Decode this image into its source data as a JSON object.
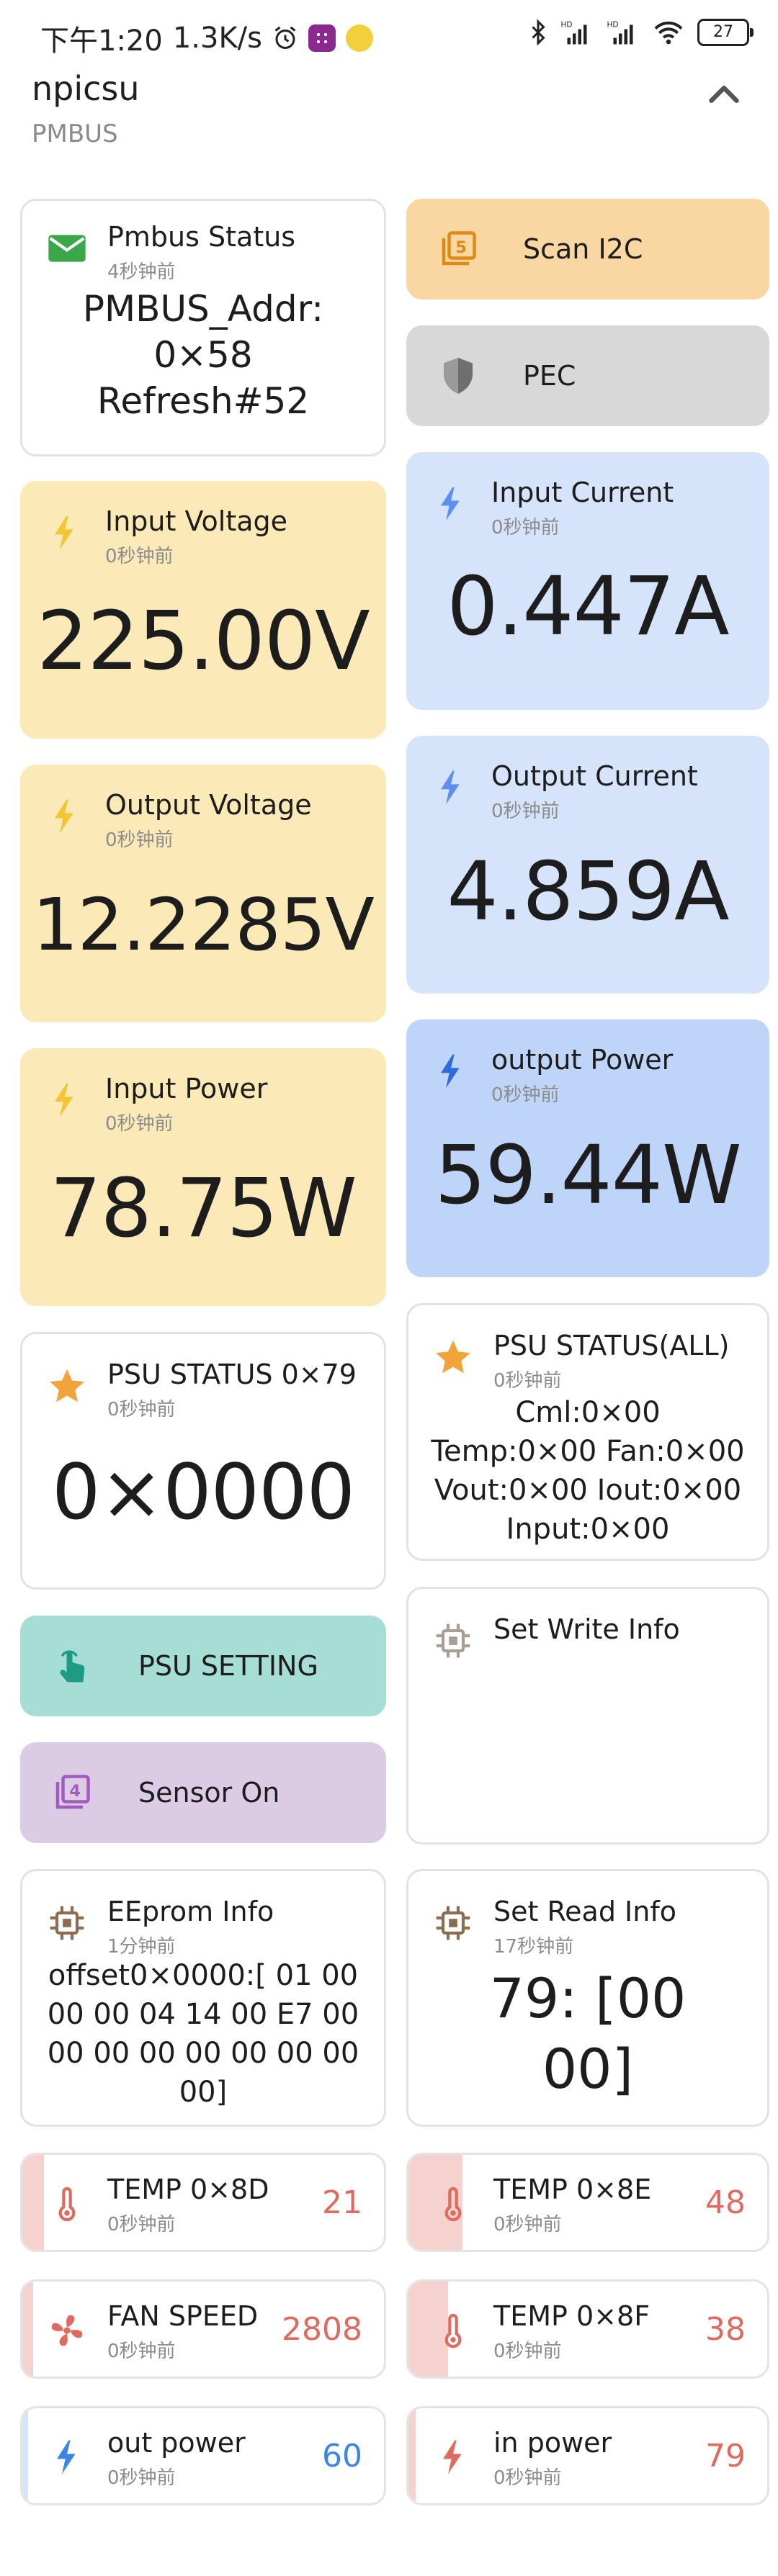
{
  "statusbar": {
    "time": "下午1:20",
    "speed": "1.3K/s",
    "battery": "27",
    "icons": [
      "alarm-icon",
      "app-icon",
      "cat-icon",
      "bluetooth-icon",
      "signal-hd-1-icon",
      "signal-hd-2-icon",
      "wifi-icon",
      "battery-icon"
    ]
  },
  "header": {
    "title": "npicsu",
    "subtitle": "PMBUS"
  },
  "cards": {
    "pmbus_status": {
      "title": "Pmbus Status",
      "time": "4秒钟前",
      "lines": [
        "PMBUS_Addr:",
        "0×58",
        "Refresh#52"
      ]
    },
    "scan_i2c": {
      "label": "Scan I2C"
    },
    "pec": {
      "label": "PEC"
    },
    "input_voltage": {
      "title": "Input Voltage",
      "time": "0秒钟前",
      "value": "225.00V"
    },
    "input_current": {
      "title": "Input Current",
      "time": "0秒钟前",
      "value": "0.447A"
    },
    "output_voltage": {
      "title": "Output Voltage",
      "time": "0秒钟前",
      "value": "12.2285V"
    },
    "output_current": {
      "title": "Output Current",
      "time": "0秒钟前",
      "value": "4.859A"
    },
    "input_power": {
      "title": "Input Power",
      "time": "0秒钟前",
      "value": "78.75W"
    },
    "output_power": {
      "title": "output Power",
      "time": "0秒钟前",
      "value": "59.44W"
    },
    "psu_status": {
      "title": "PSU STATUS 0×79",
      "time": "0秒钟前",
      "value": "0×0000"
    },
    "psu_status_all": {
      "title": "PSU STATUS(ALL)",
      "time": "0秒钟前",
      "lines": [
        "Cml:0×00",
        "Temp:0×00 Fan:0×00",
        "Vout:0×00 Iout:0×00",
        "Input:0×00"
      ]
    },
    "psu_setting": {
      "label": "PSU SETTING"
    },
    "set_write_info": {
      "title": "Set Write Info"
    },
    "sensor_on": {
      "label": "Sensor On"
    },
    "eeprom_info": {
      "title": "EEprom Info",
      "time": "1分钟前",
      "lines": [
        "offset0×0000:[ 01 00",
        "00 00 04 14 00 E7 00",
        "00 00 00 00 00 00 00",
        "00]"
      ]
    },
    "set_read_info": {
      "title": "Set Read Info",
      "time": "17秒钟前",
      "lines": [
        "79: [00",
        "00]"
      ]
    }
  },
  "sensors": {
    "temp_8d": {
      "title": "TEMP 0×8D",
      "time": "0秒钟前",
      "value": "21",
      "level": 0.06,
      "color": "#e06a60"
    },
    "temp_8e": {
      "title": "TEMP 0×8E",
      "time": "0秒钟前",
      "value": "48",
      "level": 0.15,
      "color": "#e06a60"
    },
    "fan_speed": {
      "title": "FAN SPEED",
      "time": "0秒钟前",
      "value": "2808",
      "level": 0.03,
      "color": "#e06a60"
    },
    "temp_8f": {
      "title": "TEMP 0×8F",
      "time": "0秒钟前",
      "value": "38",
      "level": 0.11,
      "color": "#e06a60"
    },
    "out_power": {
      "title": "out power",
      "time": "0秒钟前",
      "value": "60",
      "level": 0.01,
      "color": "#3b86e3"
    },
    "in_power": {
      "title": "in power",
      "time": "0秒钟前",
      "value": "79",
      "level": 0.02,
      "color": "#e06a60"
    }
  },
  "colors": {
    "yellow_card": "#fbe9b7",
    "blue_card": "#d5e3fb",
    "sensor_red_fill": "#f6d2cf",
    "sensor_blue_fill": "#d5e3fb",
    "bolt_yellow": "#f2c531",
    "bolt_blue": "#4a82ea",
    "star": "#f2a33a"
  }
}
